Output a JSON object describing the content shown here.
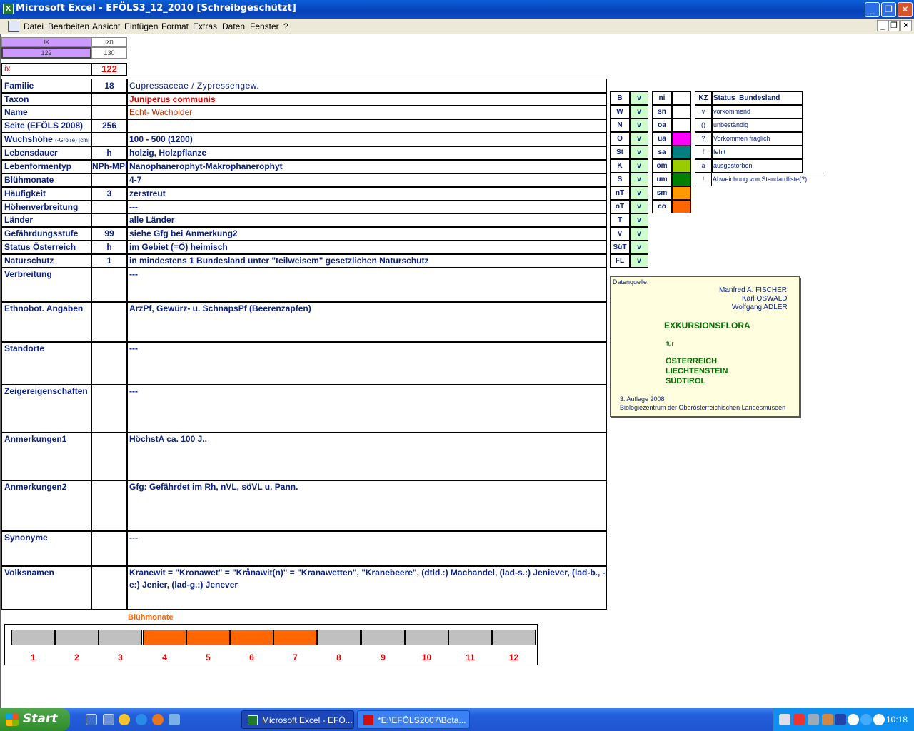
{
  "window": {
    "title": "Microsoft Excel - EFÖLS3_12_2010  [Schreibgeschützt]"
  },
  "menu": [
    "Datei",
    "Bearbeiten",
    "Ansicht",
    "Einfügen",
    "Format",
    "Extras",
    "Daten",
    "Fenster",
    "?"
  ],
  "top": {
    "h1": "ix",
    "h2": "ixn",
    "v1": "122",
    "v2": "130",
    "ix_label": "ix",
    "ix_value": "122"
  },
  "rows": [
    {
      "label": "Familie",
      "mid": "18",
      "value": "Cupressaceae / Zypressengew."
    },
    {
      "label": "Taxon",
      "mid": "",
      "value": "Juniperus communis"
    },
    {
      "label": "Name",
      "mid": "",
      "value": "Echt- Wacholder"
    },
    {
      "label": "Seite (EFÖLS 2008)",
      "mid": "256",
      "value": ""
    },
    {
      "label": "Wuchshöhe",
      "label_suffix": "(-Größe) [cm]",
      "mid": "",
      "value": "100 - 500 (1200)"
    },
    {
      "label": "Lebensdauer",
      "mid": "h",
      "value": "holzig, Holzpflanze"
    },
    {
      "label": "Lebenformentyp",
      "mid": "NPh-MPh",
      "value": "Nanophanerophyt-Makrophanerophyt"
    },
    {
      "label": "Blühmonate",
      "mid": "",
      "value": "4-7"
    },
    {
      "label": "Häufigkeit",
      "mid": "3",
      "value": "zerstreut"
    },
    {
      "label": "Höhenverbreitung",
      "mid": "",
      "value": "---"
    },
    {
      "label": "Länder",
      "mid": "",
      "value": "alle Länder"
    },
    {
      "label": "Gefährdungsstufe",
      "mid": "99",
      "value": "siehe Gfg bei Anmerkung2"
    },
    {
      "label": "Status Österreich",
      "mid": "h",
      "value": "im Gebiet (=Ö) heimisch"
    },
    {
      "label": "Naturschutz",
      "mid": "1",
      "value": "in mindestens 1 Bundesland unter \"teilweisem\" gesetzlichen Naturschutz"
    },
    {
      "label": "Verbreitung",
      "mid": "",
      "value": "---"
    },
    {
      "label": "Ethnobot. Angaben",
      "mid": "",
      "value": "ArzPf, Gewürz- u. SchnapsPf (Beerenzapfen)"
    },
    {
      "label": "Standorte",
      "mid": "",
      "value": "---"
    },
    {
      "label": "Zeigereigenschaften",
      "mid": "",
      "value": "---"
    },
    {
      "label": "Anmerkungen1",
      "mid": "",
      "value": "HöchstA ca. 100 J.."
    },
    {
      "label": "Anmerkungen2",
      "mid": "",
      "value": "Gfg: Gefährdet im Rh, nVL, söVL u. Pann."
    },
    {
      "label": "Synonyme",
      "mid": "",
      "value": "---"
    },
    {
      "label": "Volksnamen",
      "mid": "",
      "value": "Kranewit = \"Kronawet\" = \"Krånawit(n)\" = \"Kranawetten\", \"Kranebeere\",  (dtld.:) Machandel, (lad-s.:) Jeniever, (lad-b., -e:) Jenier, (lad-g.:) Jenever"
    }
  ],
  "regions": [
    [
      "B",
      "v"
    ],
    [
      "W",
      "v"
    ],
    [
      "N",
      "v"
    ],
    [
      "O",
      "v"
    ],
    [
      "St",
      "v"
    ],
    [
      "K",
      "v"
    ],
    [
      "S",
      "v"
    ],
    [
      "nT",
      "v"
    ],
    [
      "oT",
      "v"
    ],
    [
      "T",
      "v"
    ],
    [
      "V",
      "v"
    ],
    [
      "SüT",
      "v"
    ],
    [
      "FL",
      "v"
    ]
  ],
  "altitude": [
    {
      "code": "ni",
      "color": "#ffffff"
    },
    {
      "code": "sn",
      "color": "#ffffff"
    },
    {
      "code": "oa",
      "color": "#ffffff"
    },
    {
      "code": "ua",
      "color": "#ff00ff"
    },
    {
      "code": "sa",
      "color": "#008080"
    },
    {
      "code": "om",
      "color": "#99cc00"
    },
    {
      "code": "um",
      "color": "#008000"
    },
    {
      "code": "sm",
      "color": "#ff9900"
    },
    {
      "code": "co",
      "color": "#ff6600"
    }
  ],
  "status_legend": {
    "kz": "KZ",
    "title": "Status_Bundesland",
    "items": [
      [
        "v",
        "vorkommend"
      ],
      [
        "()",
        "unbeständig"
      ],
      [
        "?",
        "Vorkommen fraglich"
      ],
      [
        "f",
        "fehlt"
      ],
      [
        "a",
        "ausgestorben"
      ],
      [
        "!",
        "Abweichung von Standardliste(?)"
      ]
    ]
  },
  "source": {
    "label": "Datenquelle:",
    "authors": [
      "Manfred A. FISCHER",
      "Karl OSWALD",
      "Wolfgang ADLER"
    ],
    "title": "EXKURSIONSFLORA",
    "fuer": "für",
    "countries": [
      "ÖSTERREICH",
      "LIECHTENSTEIN",
      "SÜDTIROL"
    ],
    "edition": "3. Auflage 2008",
    "publisher": "Biologiezentrum der Oberösterreichischen Landesmuseen"
  },
  "bloom": {
    "title": "Blühmonate",
    "months": [
      "1",
      "2",
      "3",
      "4",
      "5",
      "6",
      "7",
      "8",
      "9",
      "10",
      "11",
      "12"
    ],
    "active": [
      4,
      5,
      6,
      7
    ],
    "active_color": "#ff6600",
    "inactive_color": "#c0c0c0"
  },
  "taskbar": {
    "start": "Start",
    "tasks": [
      "Microsoft Excel - EFÖ...",
      "*E:\\EFÖLS2007\\Bota..."
    ],
    "clock": "10:18"
  }
}
